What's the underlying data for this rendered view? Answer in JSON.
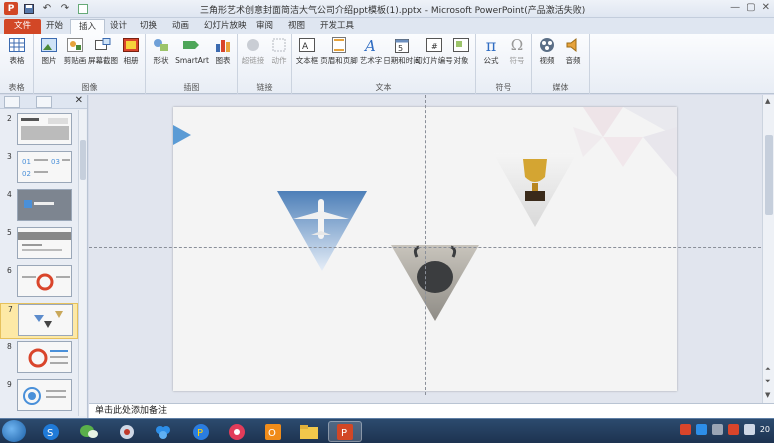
{
  "window": {
    "title": "三角形艺术创意封面简洁大气公司介绍ppt模板(1).pptx - Microsoft PowerPoint(产品激活失败)",
    "controls": [
      "minimize-icon",
      "maximize-icon",
      "close-icon"
    ]
  },
  "quick_access": [
    "ppt-logo",
    "save-icon",
    "undo-icon",
    "redo-icon",
    "new-slide-icon"
  ],
  "tabs": [
    {
      "label": "文件"
    },
    {
      "label": "开始"
    },
    {
      "label": "插入"
    },
    {
      "label": "设计"
    },
    {
      "label": "切换"
    },
    {
      "label": "动画"
    },
    {
      "label": "幻灯片放映"
    },
    {
      "label": "审阅"
    },
    {
      "label": "视图"
    },
    {
      "label": "开发工具"
    }
  ],
  "active_tab": "插入",
  "ribbon": {
    "groups": [
      {
        "label": "表格",
        "buttons": [
          {
            "label": "表格",
            "icon": "table-icon"
          }
        ]
      },
      {
        "label": "图像",
        "buttons": [
          {
            "label": "图片",
            "icon": "picture-icon"
          },
          {
            "label": "剪贴画",
            "icon": "clipart-icon"
          },
          {
            "label": "屏幕截图",
            "icon": "screenshot-icon"
          },
          {
            "label": "相册",
            "icon": "album-icon"
          }
        ]
      },
      {
        "label": "插图",
        "buttons": [
          {
            "label": "形状",
            "icon": "shapes-icon"
          },
          {
            "label": "SmartArt",
            "icon": "smartart-icon"
          },
          {
            "label": "图表",
            "icon": "chart-icon"
          }
        ]
      },
      {
        "label": "链接",
        "buttons": [
          {
            "label": "超链接",
            "icon": "hyperlink-icon"
          },
          {
            "label": "动作",
            "icon": "action-icon"
          }
        ]
      },
      {
        "label": "文本",
        "buttons": [
          {
            "label": "文本框",
            "icon": "textbox-icon"
          },
          {
            "label": "页眉和页脚",
            "icon": "header-footer-icon"
          },
          {
            "label": "艺术字",
            "icon": "wordart-icon"
          },
          {
            "label": "日期和时间",
            "icon": "datetime-icon"
          },
          {
            "label": "幻灯片编号",
            "icon": "slide-number-icon"
          },
          {
            "label": "对象",
            "icon": "object-icon"
          }
        ]
      },
      {
        "label": "符号",
        "buttons": [
          {
            "label": "公式",
            "icon": "equation-icon"
          },
          {
            "label": "符号",
            "icon": "symbol-icon"
          }
        ]
      },
      {
        "label": "媒体",
        "buttons": [
          {
            "label": "视频",
            "icon": "video-icon"
          },
          {
            "label": "音频",
            "icon": "audio-icon"
          }
        ]
      }
    ]
  },
  "slide_panel": {
    "slides": [
      {
        "number": "2"
      },
      {
        "number": "3"
      },
      {
        "number": "4"
      },
      {
        "number": "5"
      },
      {
        "number": "6"
      },
      {
        "number": "7"
      },
      {
        "number": "8"
      },
      {
        "number": "9"
      }
    ],
    "selected": "7"
  },
  "current_slide": {
    "images": [
      "airplane-photo",
      "trophy-photo",
      "bull-statue-photo"
    ]
  },
  "notes": {
    "placeholder": "单击此处添加备注"
  },
  "taskbar": {
    "apps": [
      "sogou-icon",
      "wechat-icon",
      "network-icon",
      "baidu-netdisk-icon",
      "browser-icon",
      "camera-icon",
      "office-icon",
      "folder-icon",
      "powerpoint-icon"
    ],
    "clock": "20"
  },
  "colors": {
    "accent_file_tab": "#d24726",
    "slide_blue_triangle": "#4a90d9",
    "selected_thumb": "#fde9a6"
  }
}
